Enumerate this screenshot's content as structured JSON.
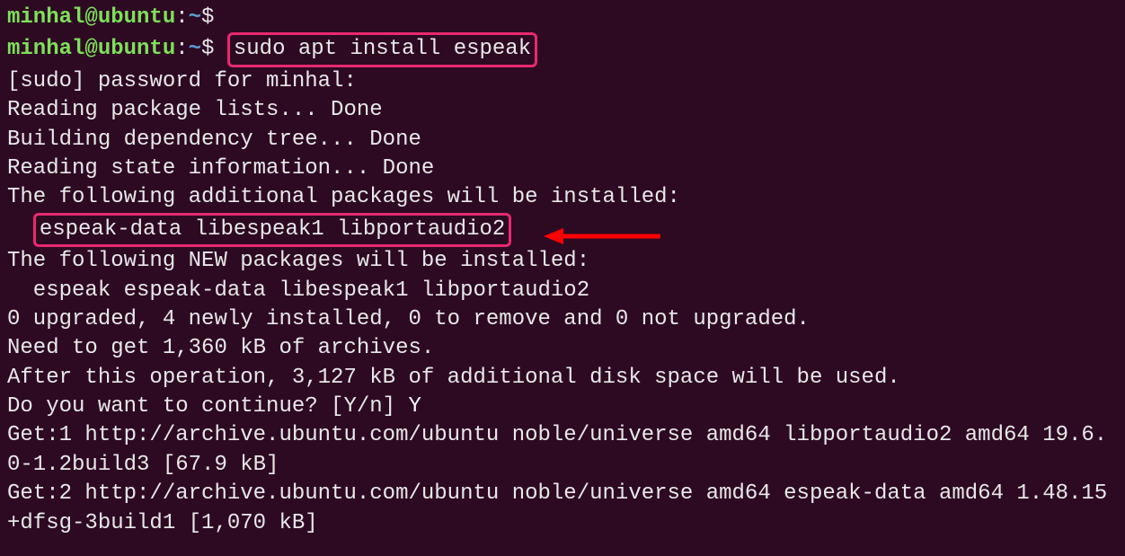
{
  "prompt": {
    "user": "minhal@ubuntu",
    "colon": ":",
    "path": "~",
    "dollar": "$"
  },
  "cmd1": "",
  "cmd2": "sudo apt install espeak",
  "out": {
    "l1": "[sudo] password for minhal:",
    "l2": "Reading package lists... Done",
    "l3": "Building dependency tree... Done",
    "l4": "Reading state information... Done",
    "l5": "The following additional packages will be installed:",
    "l6": "espeak-data libespeak1 libportaudio2",
    "l7": "The following NEW packages will be installed:",
    "l8": "  espeak espeak-data libespeak1 libportaudio2",
    "l9": "0 upgraded, 4 newly installed, 0 to remove and 0 not upgraded.",
    "l10": "Need to get 1,360 kB of archives.",
    "l11": "After this operation, 3,127 kB of additional disk space will be used.",
    "l12a": "Do you want to continue? [Y/n] ",
    "l12b": "Y",
    "l13": "Get:1 http://archive.ubuntu.com/ubuntu noble/universe amd64 libportaudio2 amd64 19.6.0-1.2build3 [67.9 kB]",
    "l14": "Get:2 http://archive.ubuntu.com/ubuntu noble/universe amd64 espeak-data amd64 1.48.15+dfsg-3build1 [1,070 kB]"
  }
}
